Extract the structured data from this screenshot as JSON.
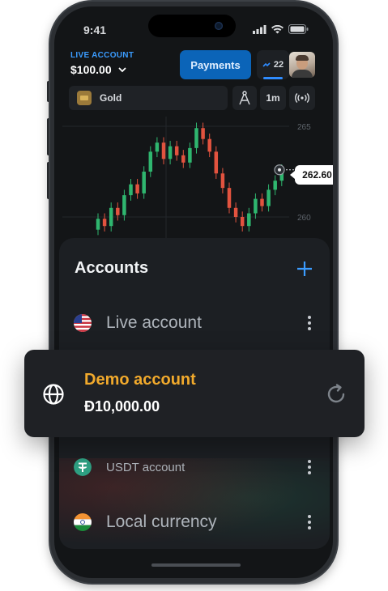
{
  "status_bar": {
    "time": "9:41"
  },
  "header": {
    "account_type_label": "LIVE ACCOUNT",
    "balance": "$100.00",
    "payments_label": "Payments",
    "notifications_count": "22"
  },
  "toolbar": {
    "asset_name": "Gold",
    "timeframe": "1m"
  },
  "chart": {
    "price_label": "262.60",
    "axis_labels": [
      "265",
      "260"
    ]
  },
  "chart_data": {
    "type": "candlestick",
    "title": "",
    "current_price": 262.6,
    "y_ticks": [
      265,
      260
    ],
    "candles": [
      {
        "o": 259.3,
        "c": 259.9
      },
      {
        "o": 259.9,
        "c": 259.5
      },
      {
        "o": 259.5,
        "c": 260.5
      },
      {
        "o": 260.5,
        "c": 260.1
      },
      {
        "o": 260.1,
        "c": 261.2
      },
      {
        "o": 261.2,
        "c": 261.8
      },
      {
        "o": 261.8,
        "c": 261.3
      },
      {
        "o": 261.3,
        "c": 262.5
      },
      {
        "o": 262.5,
        "c": 263.6
      },
      {
        "o": 263.6,
        "c": 264.1
      },
      {
        "o": 264.1,
        "c": 263.2
      },
      {
        "o": 263.2,
        "c": 263.9
      },
      {
        "o": 263.9,
        "c": 263.4
      },
      {
        "o": 263.4,
        "c": 263.0
      },
      {
        "o": 263.0,
        "c": 263.8
      },
      {
        "o": 263.8,
        "c": 264.9
      },
      {
        "o": 264.9,
        "c": 264.3
      },
      {
        "o": 264.3,
        "c": 263.6
      },
      {
        "o": 263.6,
        "c": 262.4
      },
      {
        "o": 262.4,
        "c": 261.6
      },
      {
        "o": 261.6,
        "c": 260.5
      },
      {
        "o": 260.5,
        "c": 260.0
      },
      {
        "o": 260.0,
        "c": 259.5
      },
      {
        "o": 259.5,
        "c": 260.2
      },
      {
        "o": 260.2,
        "c": 261.0
      },
      {
        "o": 261.0,
        "c": 260.6
      },
      {
        "o": 260.6,
        "c": 261.5
      },
      {
        "o": 261.5,
        "c": 262.0
      },
      {
        "o": 262.0,
        "c": 262.6
      }
    ]
  },
  "accounts_sheet": {
    "title": "Accounts",
    "items": [
      {
        "label": "Live account"
      },
      {
        "label": "USDT account"
      },
      {
        "label": "Local currency"
      }
    ]
  },
  "demo_account": {
    "title": "Demo account",
    "balance": "Đ10,000.00"
  },
  "colors": {
    "accent_blue": "#3b9cff",
    "demo_orange": "#f2aa2c",
    "candle_up": "#2fb66f",
    "candle_down": "#e2533f"
  },
  "icons": {
    "add": "plus-icon",
    "menu": "more-vertical-icon",
    "demo": "globe-icon",
    "refresh": "refresh-icon"
  }
}
